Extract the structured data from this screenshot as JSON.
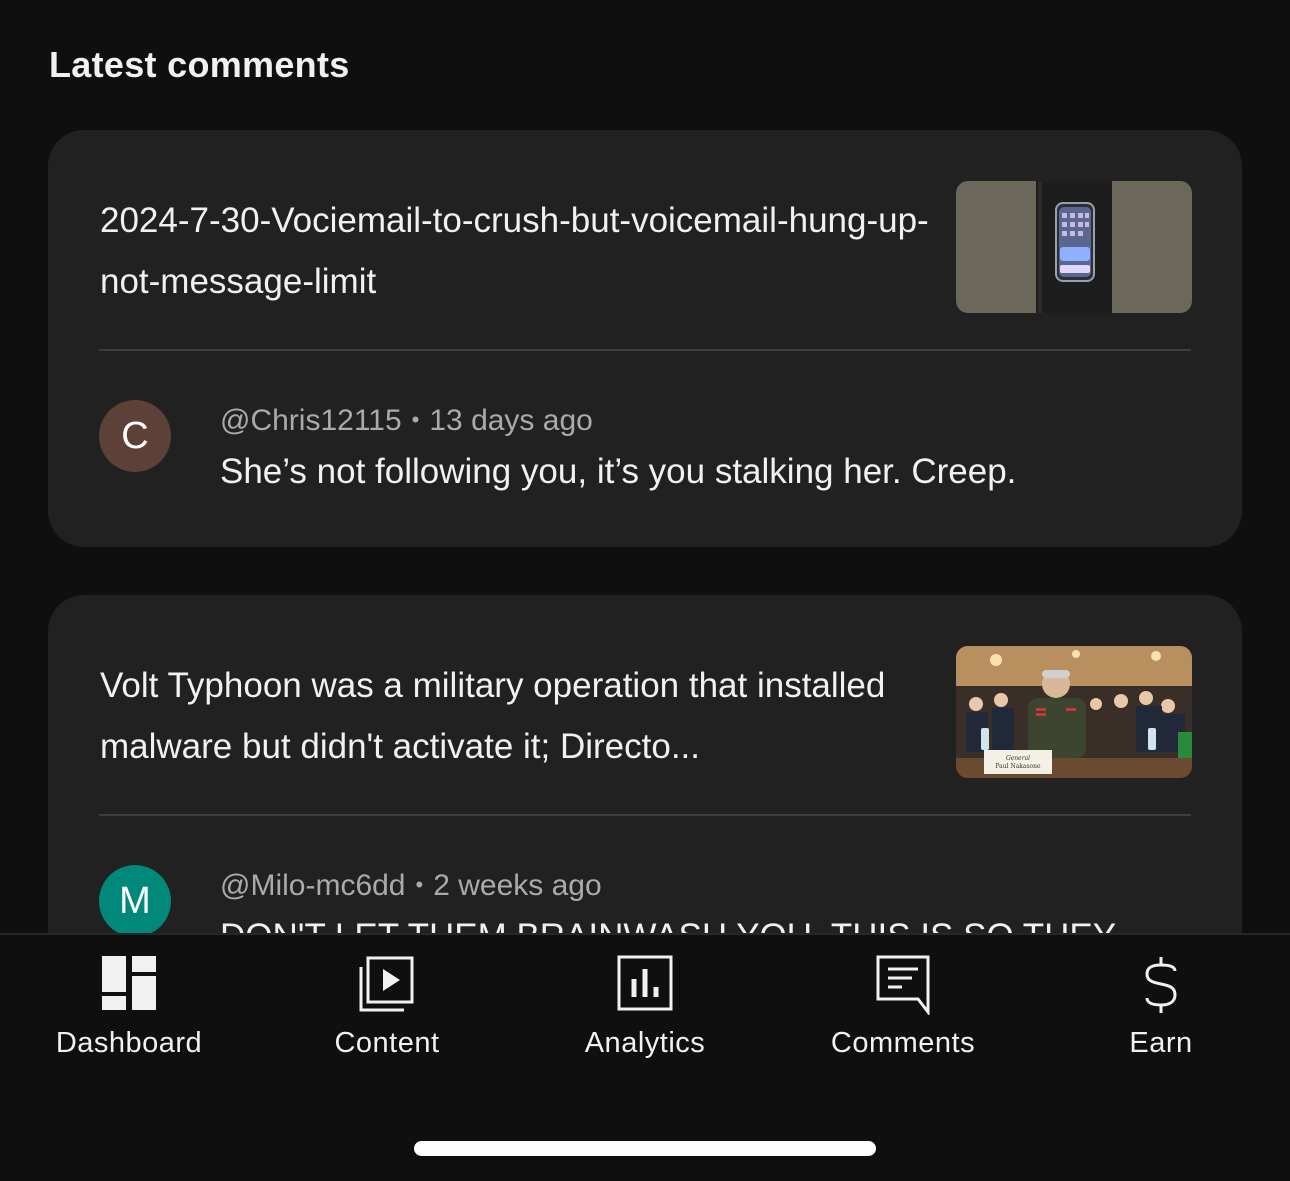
{
  "section": {
    "title": "Latest comments"
  },
  "comments": [
    {
      "video_title": "2024-7-30-Vociemail-to-crush-but-voicemail-hung-up-not-message-limit",
      "author": "@Chris12115",
      "time": "13 days ago",
      "avatar_letter": "C",
      "avatar_color": "#5d4037",
      "text": "She’s not following you, it’s you stalking her. Creep."
    },
    {
      "video_title": "Volt Typhoon was a military operation that installed malware but didn't activate it; Directo...",
      "author": "@Milo-mc6dd",
      "time": "2 weeks ago",
      "avatar_letter": "M",
      "avatar_color": "#00897b",
      "text": "DON'T LET THEM BRAINWASH YOU. THIS IS SO THEY",
      "thumbnail_nameplate": "General Paul Nakasone"
    }
  ],
  "separator": "•",
  "nav": {
    "items": [
      {
        "label": "Dashboard",
        "icon": "dashboard-icon"
      },
      {
        "label": "Content",
        "icon": "content-icon"
      },
      {
        "label": "Analytics",
        "icon": "analytics-icon"
      },
      {
        "label": "Comments",
        "icon": "comments-icon"
      },
      {
        "label": "Earn",
        "icon": "earn-icon"
      }
    ]
  },
  "colors": {
    "background": "#0f0f0f",
    "card": "#212121",
    "text": "#f1f1f1",
    "secondary_text": "#aaaaaa"
  }
}
